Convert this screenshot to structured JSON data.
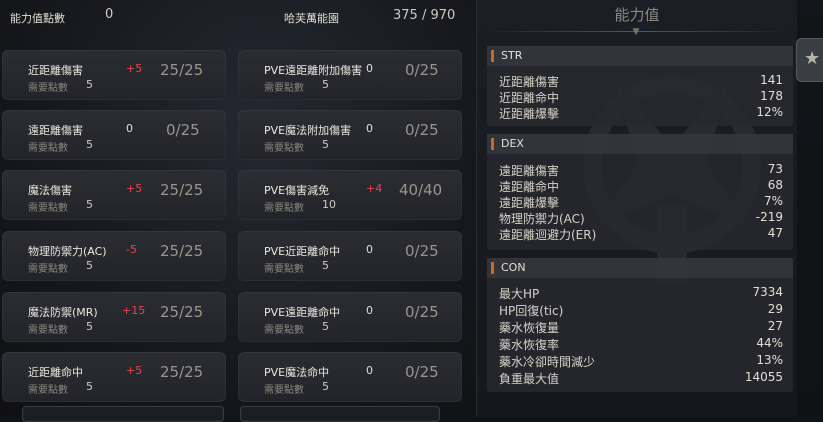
{
  "header": {
    "points_label": "能力值點數",
    "points_value": "0",
    "title": "哈芙萬能園",
    "capacity": "375 / 970"
  },
  "left_column": [
    {
      "name": "近距離傷害",
      "delta": "+5",
      "ratio": "25/25",
      "req_label": "需要點數",
      "req": "5"
    },
    {
      "name": "遠距離傷害",
      "delta": "0",
      "ratio": "0/25",
      "req_label": "需要點數",
      "req": "5"
    },
    {
      "name": "魔法傷害",
      "delta": "+5",
      "ratio": "25/25",
      "req_label": "需要點數",
      "req": "5"
    },
    {
      "name": "物理防禦力(AC)",
      "delta": "-5",
      "ratio": "25/25",
      "req_label": "需要點數",
      "req": "5"
    },
    {
      "name": "魔法防禦(MR)",
      "delta": "+15",
      "ratio": "25/25",
      "req_label": "需要點數",
      "req": "5"
    },
    {
      "name": "近距離命中",
      "delta": "+5",
      "ratio": "25/25",
      "req_label": "需要點數",
      "req": "5"
    }
  ],
  "right_column": [
    {
      "name": "PVE遠距離附加傷害",
      "delta": "0",
      "ratio": "0/25",
      "req_label": "需要點數",
      "req": "5"
    },
    {
      "name": "PVE魔法附加傷害",
      "delta": "0",
      "ratio": "0/25",
      "req_label": "需要點數",
      "req": "5"
    },
    {
      "name": "PVE傷害減免",
      "delta": "+4",
      "ratio": "40/40",
      "req_label": "需要點數",
      "req": "10"
    },
    {
      "name": "PVE近距離命中",
      "delta": "0",
      "ratio": "0/25",
      "req_label": "需要點數",
      "req": "5"
    },
    {
      "name": "PVE遠距離命中",
      "delta": "0",
      "ratio": "0/25",
      "req_label": "需要點數",
      "req": "5"
    },
    {
      "name": "PVE魔法命中",
      "delta": "0",
      "ratio": "0/25",
      "req_label": "需要點數",
      "req": "5"
    }
  ],
  "stats_panel": {
    "title": "能力值",
    "sections": [
      {
        "name": "STR",
        "rows": [
          {
            "k": "近距離傷害",
            "v": "141"
          },
          {
            "k": "近距離命中",
            "v": "178"
          },
          {
            "k": "近距離爆擊",
            "v": "12%"
          }
        ]
      },
      {
        "name": "DEX",
        "rows": [
          {
            "k": "遠距離傷害",
            "v": "73"
          },
          {
            "k": "遠距離命中",
            "v": "68"
          },
          {
            "k": "遠距離爆擊",
            "v": "7%"
          },
          {
            "k": "物理防禦力(AC)",
            "v": "-219"
          },
          {
            "k": "遠距離迴避力(ER)",
            "v": "47"
          }
        ]
      },
      {
        "name": "CON",
        "rows": [
          {
            "k": "最大HP",
            "v": "7334"
          },
          {
            "k": "HP回復(tic)",
            "v": "29"
          },
          {
            "k": "藥水恢復量",
            "v": "27"
          },
          {
            "k": "藥水恢復率",
            "v": "44%"
          },
          {
            "k": "藥水冷卻時間減少",
            "v": "13%"
          },
          {
            "k": "負重最大值",
            "v": "14055"
          }
        ]
      }
    ]
  },
  "colors": {
    "accent": "#c96a2a",
    "positive_delta": "#e8434b"
  }
}
